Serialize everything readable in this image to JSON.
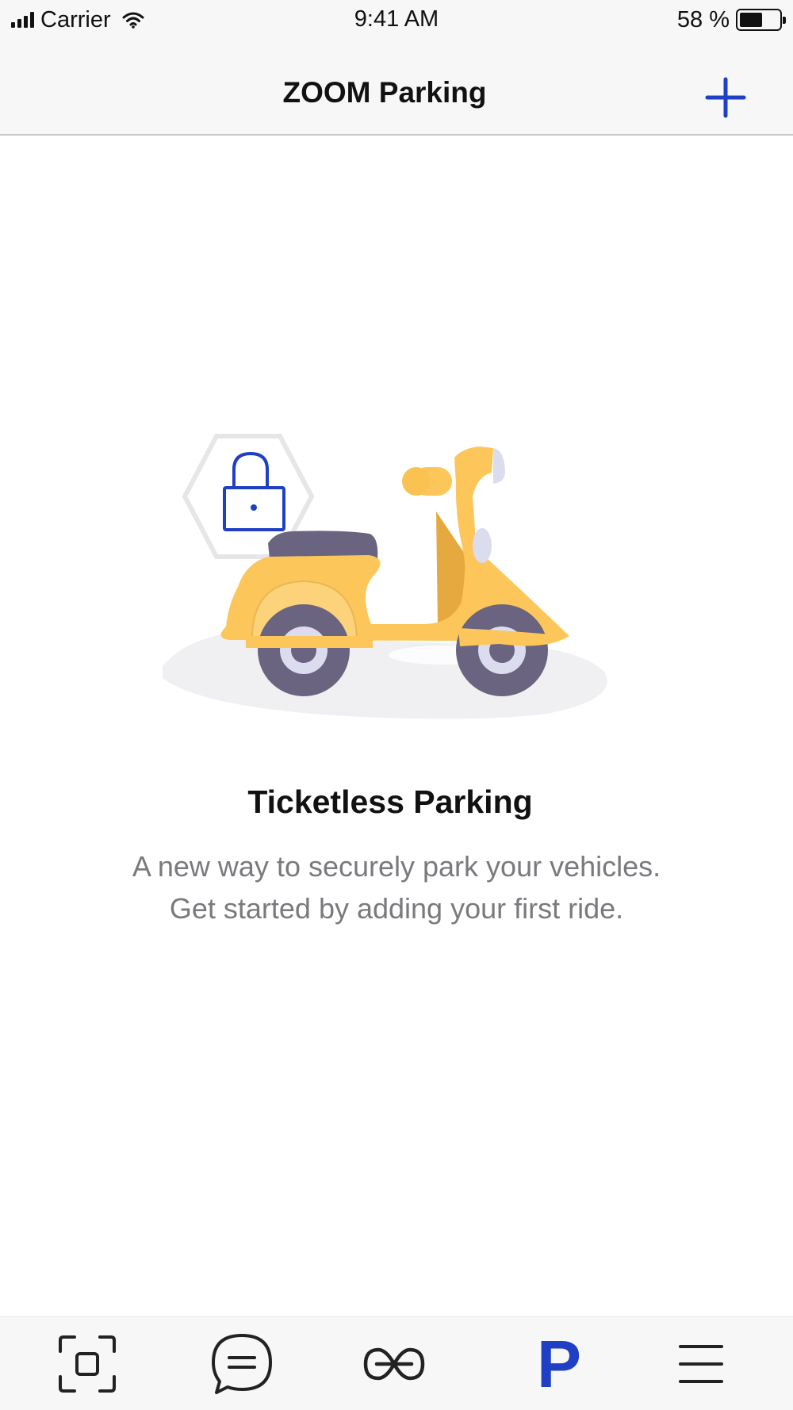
{
  "status_bar": {
    "carrier": "Carrier",
    "time": "9:41 AM",
    "battery": "58 %",
    "battery_level": 0.58
  },
  "nav": {
    "title": "ZOOM Parking",
    "add_icon": "plus-icon"
  },
  "empty_state": {
    "illustration": "scooter-with-lock-illustration",
    "title": "Ticketless Parking",
    "line1": "A new way to securely park your vehicles.",
    "line2": "Get started by adding your first ride."
  },
  "tab_bar": {
    "tabs": [
      {
        "icon": "scan-frame-icon",
        "active": false
      },
      {
        "icon": "chat-bubble-icon",
        "active": false
      },
      {
        "icon": "link-icon",
        "active": false
      },
      {
        "icon": "parking-icon",
        "label": "P",
        "active": true
      },
      {
        "icon": "menu-icon",
        "active": false
      }
    ]
  },
  "colors": {
    "accent": "#1f3fc4",
    "scooter_yellow": "#fdc65a",
    "wheel": "#6b6480",
    "text_secondary": "#7a7a7e",
    "bar_background": "#f7f7f7"
  }
}
